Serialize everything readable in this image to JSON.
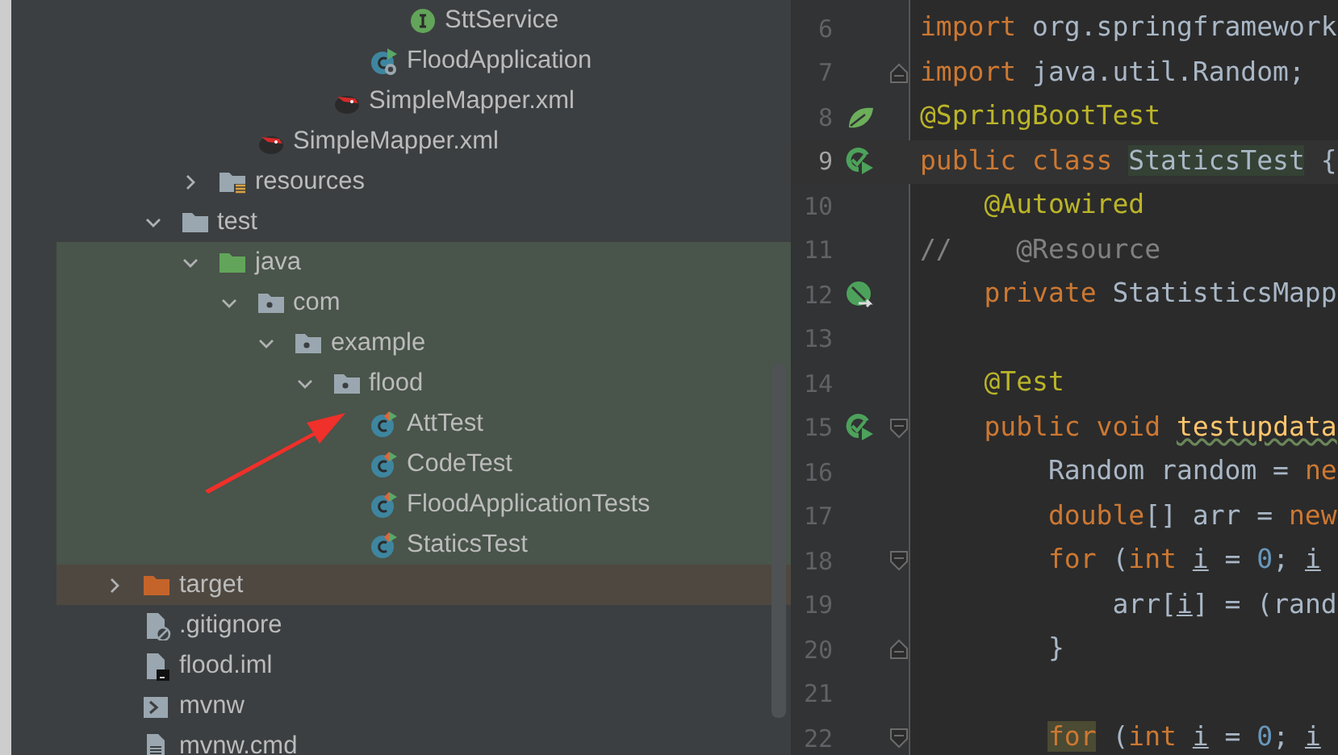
{
  "project_tree": [
    {
      "children": [
        {
          "children": [
            {
              "children": [
                {
                  "children": [
                    {
                      "children": [
                        {
                          "children": [
                            {
                              "children": [
                                {
                                  "label": "SttService",
                                  "kind": "interface"
                                }
                              ]
                            },
                            {
                              "label": "FloodApplication",
                              "kind": "boot-class"
                            }
                          ]
                        },
                        {
                          "label": "SimpleMapper.xml",
                          "kind": "mapper-xml"
                        }
                      ]
                    }
                  ]
                },
                {
                  "label": "SimpleMapper.xml",
                  "kind": "mapper-xml"
                }
              ]
            },
            {
              "label": "resources",
              "kind": "resources-folder",
              "expanded": false
            }
          ]
        },
        {
          "label": "test",
          "kind": "folder",
          "expanded": true,
          "children": [
            {
              "label": "java",
              "kind": "test-source-folder",
              "expanded": true,
              "row_highlight": {
                "kind": "test"
              },
              "children": [
                {
                  "label": "com",
                  "kind": "package",
                  "expanded": true,
                  "children": [
                    {
                      "label": "example",
                      "kind": "package",
                      "expanded": true,
                      "children": [
                        {
                          "label": "flood",
                          "kind": "package",
                          "expanded": true,
                          "children": [
                            {
                              "label": "AttTest",
                              "kind": "test-class"
                            },
                            {
                              "label": "CodeTest",
                              "kind": "test-class"
                            },
                            {
                              "label": "FloodApplicationTests",
                              "kind": "test-class"
                            },
                            {
                              "label": "StaticsTest",
                              "kind": "test-class"
                            }
                          ]
                        }
                      ]
                    }
                  ]
                }
              ]
            }
          ]
        }
      ]
    },
    {
      "label": "target",
      "kind": "excluded-folder",
      "expanded": false,
      "row_highlight": {
        "kind": "excluded"
      }
    },
    {
      "label": ".gitignore",
      "kind": "ignore-file"
    },
    {
      "label": "flood.iml",
      "kind": "module-file"
    },
    {
      "label": "mvnw",
      "kind": "script-file"
    },
    {
      "label": "mvnw.cmd",
      "kind": "text-file"
    }
  ],
  "editor": {
    "lines": [
      {
        "number": "6",
        "current": false,
        "tokens": [
          {
            "kind": "keyword",
            "text": "import"
          },
          {
            "kind": "plain",
            "text": " org.springframework"
          }
        ]
      },
      {
        "number": "7",
        "current": false,
        "fold_marker": {
          "kind": "end"
        },
        "tokens": [
          {
            "kind": "keyword",
            "text": "import"
          },
          {
            "kind": "plain",
            "text": " java.util.Random;"
          }
        ]
      },
      {
        "number": "8",
        "current": false,
        "gutter_icon": {
          "kind": "spring"
        },
        "tokens": [
          {
            "kind": "annotation",
            "text": "@SpringBootTest"
          }
        ]
      },
      {
        "number": "9",
        "current": true,
        "gutter_icon": {
          "kind": "run"
        },
        "tokens": [
          {
            "kind": "keyword",
            "text": "public class "
          },
          {
            "kind": "highlight",
            "text": "StaticsTest"
          },
          {
            "kind": "plain",
            "text": " {"
          }
        ]
      },
      {
        "number": "10",
        "current": false,
        "tokens": [
          {
            "kind": "annotation",
            "text": "    @Autowired"
          }
        ]
      },
      {
        "number": "11",
        "current": false,
        "tokens": [
          {
            "kind": "comment",
            "text": "//    @Resource"
          }
        ]
      },
      {
        "number": "12",
        "current": false,
        "gutter_icon": {
          "kind": "bean"
        },
        "tokens": [
          {
            "kind": "keyword",
            "text": "    private"
          },
          {
            "kind": "plain",
            "text": " StatisticsMapp"
          }
        ]
      },
      {
        "number": "13",
        "current": false
      },
      {
        "number": "14",
        "current": false,
        "tokens": [
          {
            "kind": "annotation",
            "text": "    @Test"
          }
        ]
      },
      {
        "number": "15",
        "current": false,
        "gutter_icon": {
          "kind": "run"
        },
        "fold_marker": {
          "kind": "start"
        },
        "tokens": [
          {
            "kind": "keyword",
            "text": "    public void "
          },
          {
            "kind": "warning",
            "text": "testupdata"
          }
        ]
      },
      {
        "number": "16",
        "current": false,
        "tokens": [
          {
            "kind": "plain",
            "text": "        Random random = "
          },
          {
            "kind": "keyword",
            "text": "ne"
          }
        ]
      },
      {
        "number": "17",
        "current": false,
        "tokens": [
          {
            "kind": "keyword",
            "text": "        double"
          },
          {
            "kind": "plain",
            "text": "[] arr = "
          },
          {
            "kind": "keyword",
            "text": "new"
          }
        ]
      },
      {
        "number": "18",
        "current": false,
        "fold_marker": {
          "kind": "start"
        },
        "tokens": [
          {
            "kind": "keyword",
            "text": "        for"
          },
          {
            "kind": "plain",
            "text": " ("
          },
          {
            "kind": "keyword",
            "text": "int "
          },
          {
            "kind": "var",
            "text": "i"
          },
          {
            "kind": "plain",
            "text": " = "
          },
          {
            "kind": "number",
            "text": "0"
          },
          {
            "kind": "plain",
            "text": "; "
          },
          {
            "kind": "var",
            "text": "i"
          }
        ]
      },
      {
        "number": "19",
        "current": false,
        "tokens": [
          {
            "kind": "plain",
            "text": "            arr["
          },
          {
            "kind": "var",
            "text": "i"
          },
          {
            "kind": "plain",
            "text": "] = (rand"
          }
        ]
      },
      {
        "number": "20",
        "current": false,
        "fold_marker": {
          "kind": "end"
        },
        "tokens": [
          {
            "kind": "plain",
            "text": "        }"
          }
        ]
      },
      {
        "number": "21",
        "current": false
      },
      {
        "number": "22",
        "current": false,
        "fold_marker": {
          "kind": "start"
        },
        "tokens": [
          {
            "kind": "match",
            "text": "        for"
          },
          {
            "kind": "plain",
            "text": " ("
          },
          {
            "kind": "keyword",
            "text": "int "
          },
          {
            "kind": "var",
            "text": "i"
          },
          {
            "kind": "plain",
            "text": " = "
          },
          {
            "kind": "number",
            "text": "0"
          },
          {
            "kind": "plain",
            "text": "; "
          },
          {
            "kind": "var",
            "text": "i"
          }
        ]
      }
    ]
  }
}
